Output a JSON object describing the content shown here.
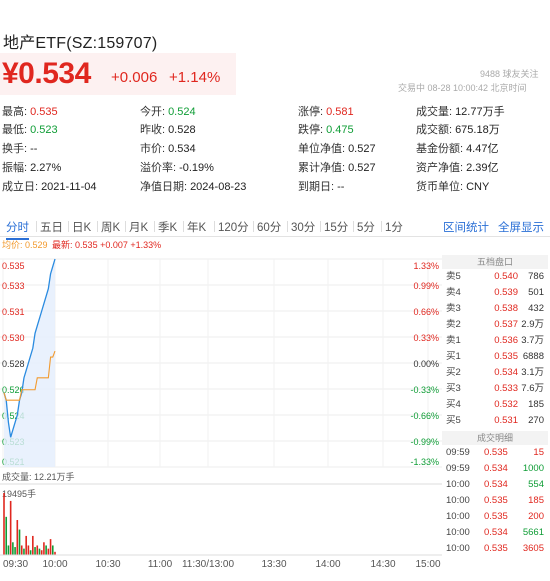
{
  "header": {
    "title": "地产ETF(SZ:159707)",
    "price": "¥0.534",
    "change": "+0.006",
    "change_pct": "+1.14%",
    "follow_text": "9488 球友关注",
    "status_text": "交易中 08-28 10:00:42 北京时间"
  },
  "stats": [
    [
      {
        "k": "最高:",
        "v": "0.535",
        "c": "red"
      },
      {
        "k": "今开:",
        "v": "0.524",
        "c": "green"
      },
      {
        "k": "涨停:",
        "v": "0.581",
        "c": "red"
      },
      {
        "k": "成交量:",
        "v": "12.77万手",
        "c": ""
      }
    ],
    [
      {
        "k": "最低:",
        "v": "0.523",
        "c": "green"
      },
      {
        "k": "昨收:",
        "v": "0.528",
        "c": ""
      },
      {
        "k": "跌停:",
        "v": "0.475",
        "c": "green"
      },
      {
        "k": "成交额:",
        "v": "675.18万",
        "c": ""
      }
    ],
    [
      {
        "k": "换手:",
        "v": "--",
        "c": ""
      },
      {
        "k": "市价:",
        "v": "0.534",
        "c": ""
      },
      {
        "k": "单位净值:",
        "v": "0.527",
        "c": ""
      },
      {
        "k": "基金份额:",
        "v": "4.47亿",
        "c": ""
      }
    ],
    [
      {
        "k": "振幅:",
        "v": "2.27%",
        "c": ""
      },
      {
        "k": "溢价率:",
        "v": "-0.19%",
        "c": ""
      },
      {
        "k": "累计净值:",
        "v": "0.527",
        "c": ""
      },
      {
        "k": "资产净值:",
        "v": "2.39亿",
        "c": ""
      }
    ],
    [
      {
        "k": "成立日:",
        "v": "2021-11-04",
        "c": ""
      },
      {
        "k": "净值日期:",
        "v": "2024-08-23",
        "c": ""
      },
      {
        "k": "到期日:",
        "v": "--",
        "c": ""
      },
      {
        "k": "货币单位:",
        "v": "CNY",
        "c": ""
      }
    ]
  ],
  "tabs": [
    "分时",
    "五日",
    "日K",
    "周K",
    "月K",
    "季K",
    "年K",
    "120分",
    "60分",
    "30分",
    "15分",
    "5分",
    "1分"
  ],
  "active_tab": 0,
  "right_links": [
    "区间统计",
    "全屏显示"
  ],
  "legend": {
    "avg": "均价: 0.529",
    "latest": "最新: 0.535 +0.007 +1.33%"
  },
  "volume_label": "成交量: 12.21万手",
  "volume_max_label": "19495手",
  "colors": {
    "red": "#e0271f",
    "green": "#0f9d36",
    "price_line": "#2a8be0",
    "avg_line": "#f29a2e",
    "accent": "#2a6fd6"
  },
  "chart_data": {
    "type": "line",
    "y_labels": [
      "0.535",
      "0.533",
      "0.531",
      "0.530",
      "0.528",
      "0.526",
      "0.524",
      "0.523",
      "0.521"
    ],
    "pct_labels": [
      "1.33%",
      "0.99%",
      "0.66%",
      "0.33%",
      "0.00%",
      "-0.33%",
      "-0.66%",
      "-0.99%",
      "-1.33%"
    ],
    "x_labels": [
      "09:30",
      "10:00",
      "10:30",
      "11:00",
      "11:30/13:00",
      "13:30",
      "14:00",
      "14:30",
      "15:00"
    ],
    "ylim": [
      0.521,
      0.535
    ],
    "price_series": [
      0.526,
      0.5255,
      0.524,
      0.523,
      0.5235,
      0.524,
      0.5245,
      0.5255,
      0.526,
      0.527,
      0.5275,
      0.528,
      0.5285,
      0.529,
      0.53,
      0.5305,
      0.531,
      0.5315,
      0.532,
      0.5325,
      0.533,
      0.534,
      0.5345,
      0.535
    ],
    "avg_series": [
      0.526,
      0.5255,
      0.5255,
      0.5255,
      0.5255,
      0.5255,
      0.5255,
      0.5255,
      0.5262,
      0.5262,
      0.5262,
      0.5262,
      0.5262,
      0.5262,
      0.5262,
      0.527,
      0.527,
      0.527,
      0.527,
      0.527,
      0.527,
      0.5284,
      0.5284,
      0.5288
    ],
    "volumes": [
      19495,
      12000,
      3000,
      17000,
      4000,
      2500,
      11000,
      8000,
      3000,
      2000,
      6000,
      3000,
      1500,
      6000,
      2500,
      3000,
      2000,
      1500,
      4000,
      3000,
      2000,
      5000,
      3000,
      1000
    ],
    "volume_colors": [
      "r",
      "g",
      "g",
      "r",
      "g",
      "g",
      "r",
      "g",
      "r",
      "g",
      "r",
      "r",
      "g",
      "r",
      "g",
      "r",
      "g",
      "r",
      "r",
      "g",
      "r",
      "r",
      "g",
      "r"
    ]
  },
  "order_book": {
    "header": "五档盘口",
    "rows": [
      {
        "l": "卖5",
        "p": "0.540",
        "q": "786"
      },
      {
        "l": "卖4",
        "p": "0.539",
        "q": "501"
      },
      {
        "l": "卖3",
        "p": "0.538",
        "q": "432"
      },
      {
        "l": "卖2",
        "p": "0.537",
        "q": "2.9万"
      },
      {
        "l": "卖1",
        "p": "0.536",
        "q": "3.7万"
      },
      {
        "l": "买1",
        "p": "0.535",
        "q": "6888"
      },
      {
        "l": "买2",
        "p": "0.534",
        "q": "3.1万"
      },
      {
        "l": "买3",
        "p": "0.533",
        "q": "7.6万"
      },
      {
        "l": "买4",
        "p": "0.532",
        "q": "185"
      },
      {
        "l": "买5",
        "p": "0.531",
        "q": "270"
      }
    ]
  },
  "trades": {
    "header": "成交明细",
    "rows": [
      {
        "t": "09:59",
        "p": "0.535",
        "q": "15",
        "c": "red"
      },
      {
        "t": "09:59",
        "p": "0.534",
        "q": "1000",
        "c": "green"
      },
      {
        "t": "10:00",
        "p": "0.534",
        "q": "554",
        "c": "green"
      },
      {
        "t": "10:00",
        "p": "0.535",
        "q": "185",
        "c": "red"
      },
      {
        "t": "10:00",
        "p": "0.535",
        "q": "200",
        "c": "red"
      },
      {
        "t": "10:00",
        "p": "0.534",
        "q": "5661",
        "c": "green"
      },
      {
        "t": "10:00",
        "p": "0.535",
        "q": "3605",
        "c": "red"
      }
    ]
  }
}
